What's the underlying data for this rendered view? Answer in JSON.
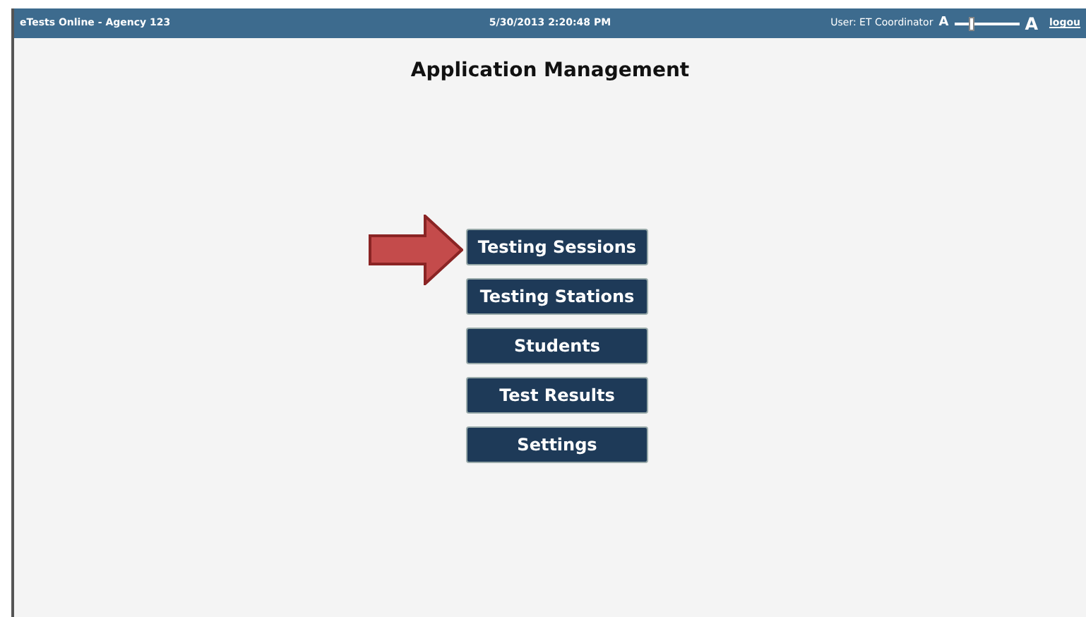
{
  "header": {
    "app_title": "eTests Online - Agency 123",
    "datetime": "5/30/2013 2:20:48 PM",
    "user": "User: ET Coordinator",
    "font_size": {
      "small_label": "A",
      "large_label": "A",
      "level": 0.25
    },
    "logout": "logou"
  },
  "page_title": "Application Management",
  "menu_buttons": [
    {
      "label": "Testing Sessions"
    },
    {
      "label": "Testing Stations"
    },
    {
      "label": "Students"
    },
    {
      "label": "Test Results"
    },
    {
      "label": "Settings"
    }
  ]
}
